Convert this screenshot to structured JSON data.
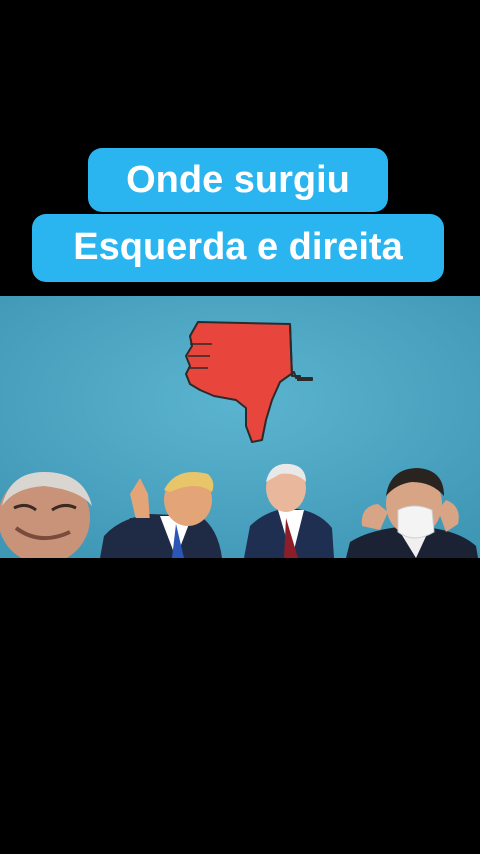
{
  "caption": {
    "line1": "Onde surgiu",
    "line2": "Esquerda e direita"
  },
  "colors": {
    "background": "#000000",
    "caption_bg": "#2bb5f0",
    "caption_text": "#ffffff",
    "scene_bg": "#4ea7c4",
    "thumb": "#e8453c"
  },
  "icons": {
    "thumb": "thumbs-down-icon"
  }
}
